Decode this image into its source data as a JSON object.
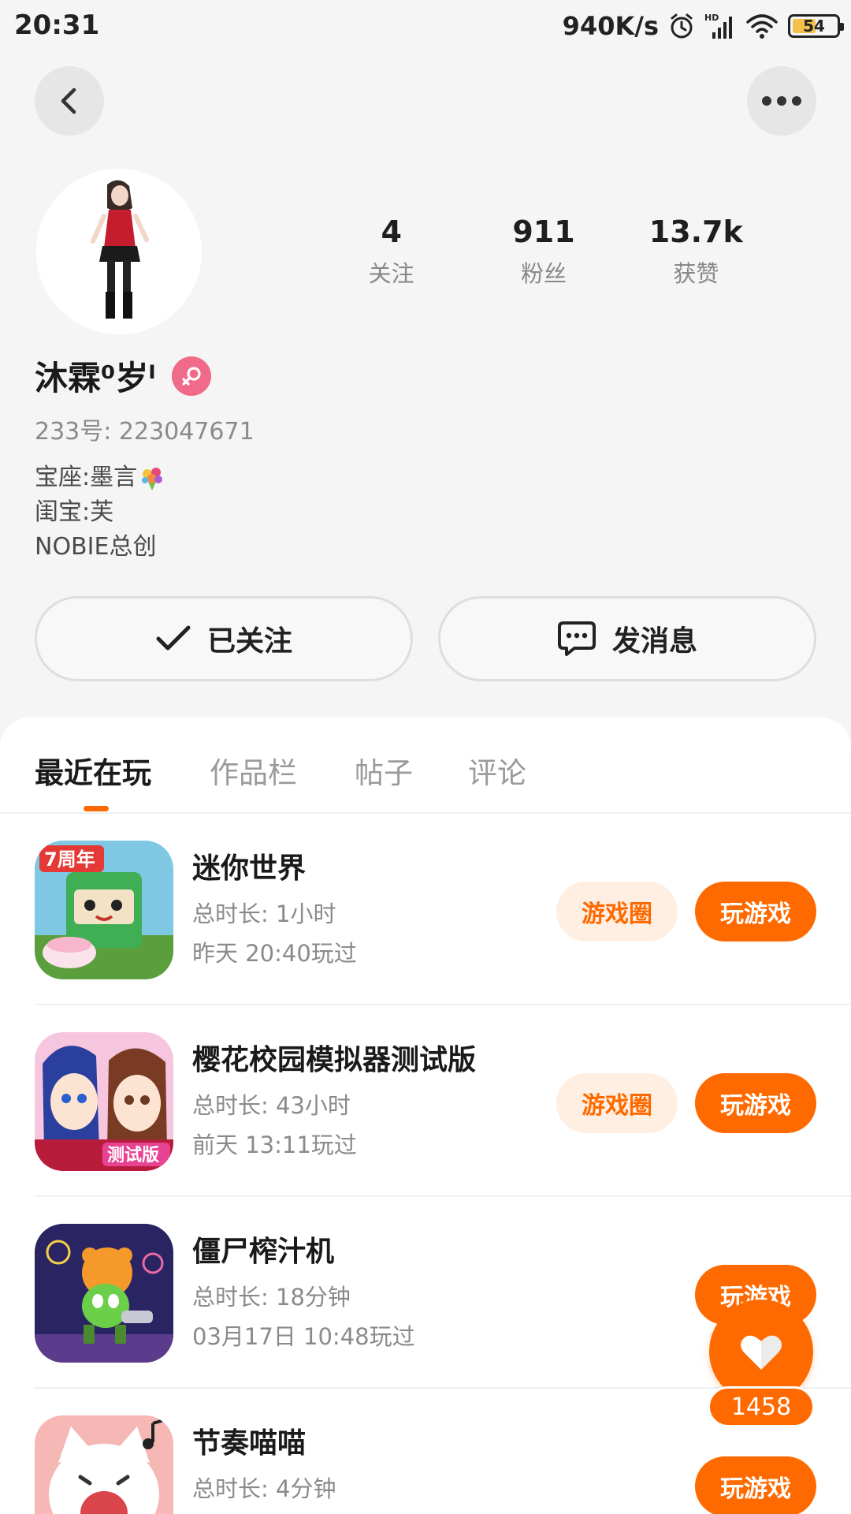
{
  "status_bar": {
    "time": "20:31",
    "net_speed": "940K/s",
    "battery": "54",
    "battery_level": 0.54
  },
  "nav": {
    "back_icon": "chevron-left-icon",
    "more_icon": "more-horizontal-icon"
  },
  "profile": {
    "name": "沐霖⁰岁ˡ",
    "account_id": "233号: 223047671",
    "gender": "female",
    "bio": [
      "宝座:墨言",
      "闺宝:芙",
      "NOBIE总创"
    ],
    "stats": [
      {
        "value": "4",
        "label": "关注"
      },
      {
        "value": "911",
        "label": "粉丝"
      },
      {
        "value": "13.7k",
        "label": "获赞"
      }
    ]
  },
  "actions": {
    "follow_label": "已关注",
    "message_label": "发消息"
  },
  "tabs": [
    {
      "label": "最近在玩",
      "active": true
    },
    {
      "label": "作品栏",
      "active": false
    },
    {
      "label": "帖子",
      "active": false
    },
    {
      "label": "评论",
      "active": false
    }
  ],
  "games": [
    {
      "title": "迷你世界",
      "duration": "总时长: 1小时",
      "last_played": "昨天 20:40玩过",
      "circle_label": "游戏圈",
      "play_label": "玩游戏"
    },
    {
      "title": "樱花校园模拟器测试版",
      "duration": "总时长: 43小时",
      "last_played": "前天 13:11玩过",
      "circle_label": "游戏圈",
      "play_label": "玩游戏",
      "icon_badge": "测试版"
    },
    {
      "title": "僵尸榨汁机",
      "duration": "总时长: 18分钟",
      "last_played": "03月17日 10:48玩过",
      "play_label": "玩游戏"
    },
    {
      "title": "节奏喵喵",
      "duration": "总时长: 4分钟",
      "play_label": "玩游戏"
    }
  ],
  "like": {
    "count": "1458"
  },
  "colors": {
    "accent": "#ff6a00",
    "accent_light": "#ffefe3",
    "female_badge": "#f06b8a"
  }
}
